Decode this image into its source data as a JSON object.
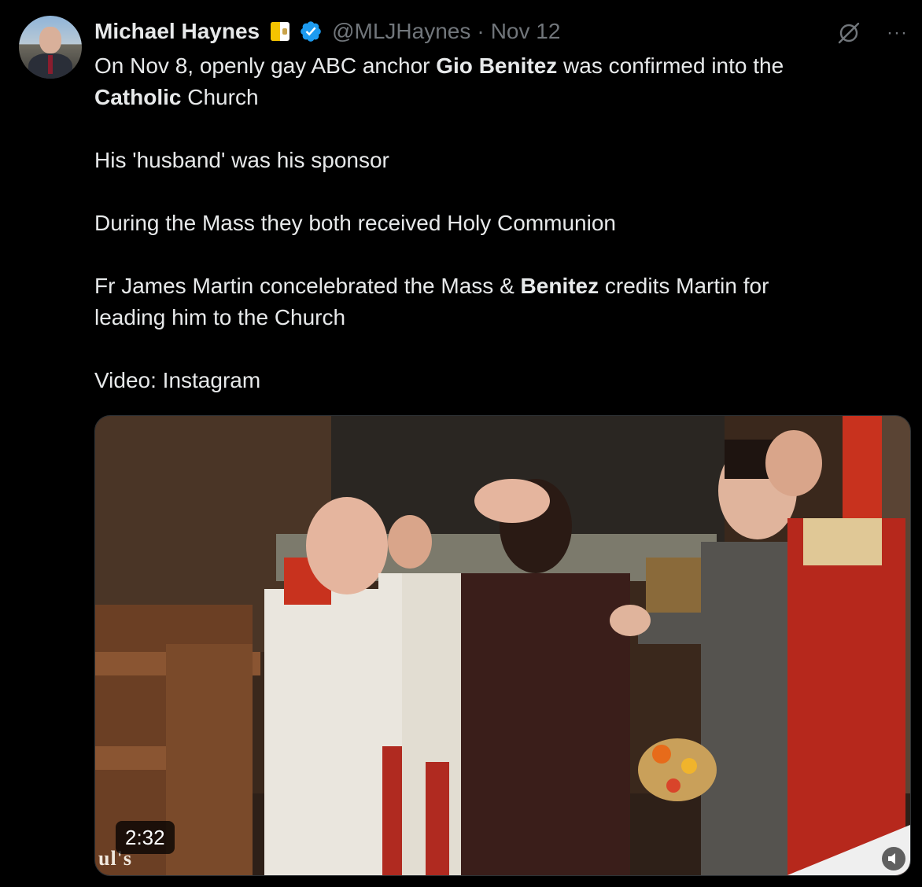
{
  "author": {
    "name": "Michael Haynes",
    "handle": "@MLJHaynes",
    "separator": "·",
    "date": "Nov 12",
    "flag_icon": "vatican-flag-icon",
    "verified_icon": "verified-badge-icon"
  },
  "header_icons": {
    "grok": "grok-icon",
    "more": "···"
  },
  "tweet": {
    "line1_a": "On Nov 8, openly gay ABC anchor ",
    "line1_b": "Gio Benitez",
    "line1_c": " was confirmed into the",
    "line2_a": "Catholic",
    "line2_b": " Church",
    "para2": "His 'husband' was his sponsor",
    "para3": "During the Mass they both received Holy Communion",
    "para4_a": "Fr James Martin concelebrated the Mass & ",
    "para4_b": "Benitez",
    "para4_c": " credits Martin for",
    "para4_d": "leading him to the Church",
    "para5": "Video: Instagram"
  },
  "video": {
    "duration": "2:32",
    "watermark": "ul's",
    "speaker_icon": "speaker-muted-icon"
  },
  "colors": {
    "background": "#000000",
    "text": "#e7e9ea",
    "muted": "#71767b",
    "verified": "#1d9bf0"
  }
}
